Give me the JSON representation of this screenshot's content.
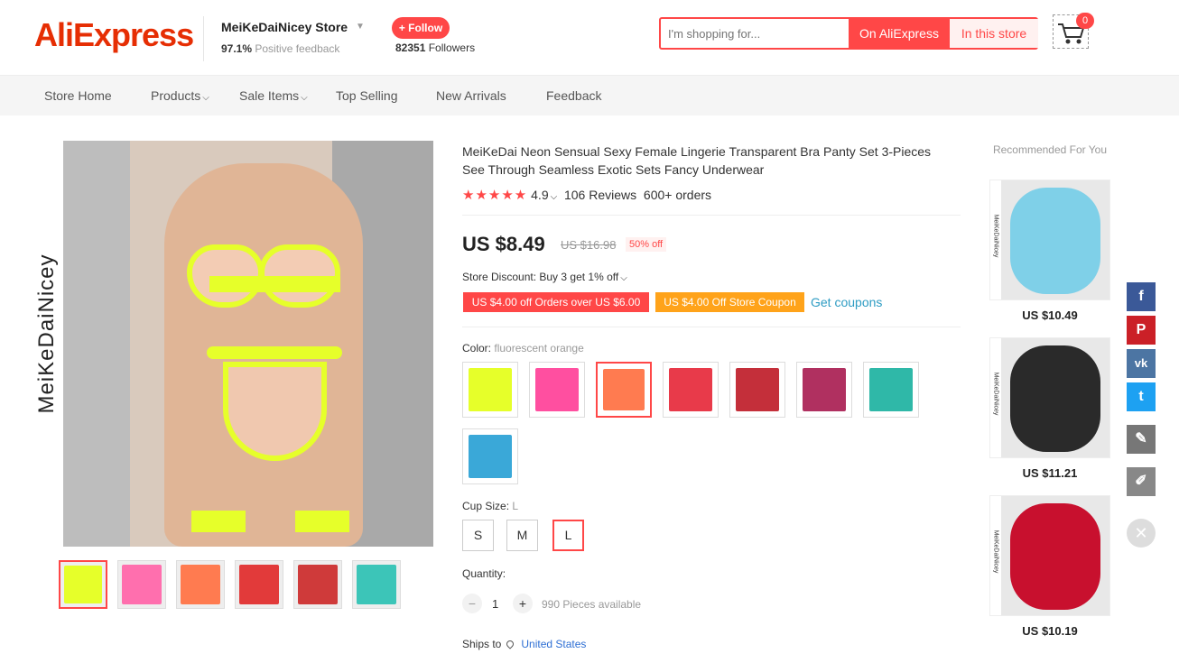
{
  "header": {
    "logo": "AliExpress",
    "store_name": "MeiKeDaiNicey Store",
    "positive_pct": "97.1%",
    "positive_label": "Positive feedback",
    "follow_label": "+ Follow",
    "followers_count": "82351",
    "followers_label": "Followers",
    "search_placeholder": "I'm shopping for...",
    "search_ae_label": "On AliExpress",
    "search_store_label": "In this store",
    "cart_count": "0"
  },
  "nav": [
    "Store Home",
    "Products",
    "Sale Items",
    "Top Selling",
    "New Arrivals",
    "Feedback"
  ],
  "gallery": {
    "brand": "MeiKeDaiNicey",
    "thumb_colors": [
      "#e6ff2a",
      "#ff6fae",
      "#ff7b50",
      "#e23a3a",
      "#cf3a3a",
      "#3cc5b8"
    ]
  },
  "product": {
    "title": "MeiKeDai Neon Sensual Sexy Female Lingerie Transparent Bra Panty Set 3-Pieces See Through Seamless Exotic Sets Fancy Underwear",
    "rating": "4.9",
    "reviews": "106 Reviews",
    "orders": "600+ orders",
    "price": "US $8.49",
    "old_price": "US $16.98",
    "discount": "50% off",
    "store_discount": "Store Discount: Buy 3 get 1% off",
    "coupon1": "US $4.00 off Orders over US $6.00",
    "coupon2": "US $4.00 Off Store Coupon",
    "get_coupons": "Get coupons",
    "color_label": "Color:",
    "color_value": "fluorescent orange",
    "color_swatches": [
      "#e6ff2a",
      "#ff4fa0",
      "#ff7b50",
      "#e83a4a",
      "#c42f3a",
      "#b03060",
      "#2fb8a8",
      "#3aa8d8"
    ],
    "cup_label": "Cup Size:",
    "cup_value": "L",
    "sizes": [
      "S",
      "M",
      "L"
    ],
    "quantity_label": "Quantity:",
    "quantity": "1",
    "qty_minus": "−",
    "qty_plus": "+",
    "available": "990 Pieces available",
    "ships_label": "Ships to",
    "ships_dest": "United States"
  },
  "recommended": {
    "title": "Recommended For You",
    "brand": "MeiKeDaiNicey",
    "items": [
      {
        "price": "US $10.49",
        "color": "#7fd0e8"
      },
      {
        "price": "US $11.21",
        "color": "#2a2a2a"
      },
      {
        "price": "US $10.19",
        "color": "#c8102e"
      }
    ]
  },
  "share": {
    "facebook": "f",
    "pinterest": "P",
    "vk": "vk",
    "twitter": "t",
    "edit": "✎",
    "pen": "✐",
    "close": "✕",
    "colors": {
      "facebook": "#3b5998",
      "pinterest": "#cb2027",
      "vk": "#4c75a3",
      "twitter": "#1da1f2",
      "edit": "#777777",
      "pen": "#888888"
    }
  }
}
